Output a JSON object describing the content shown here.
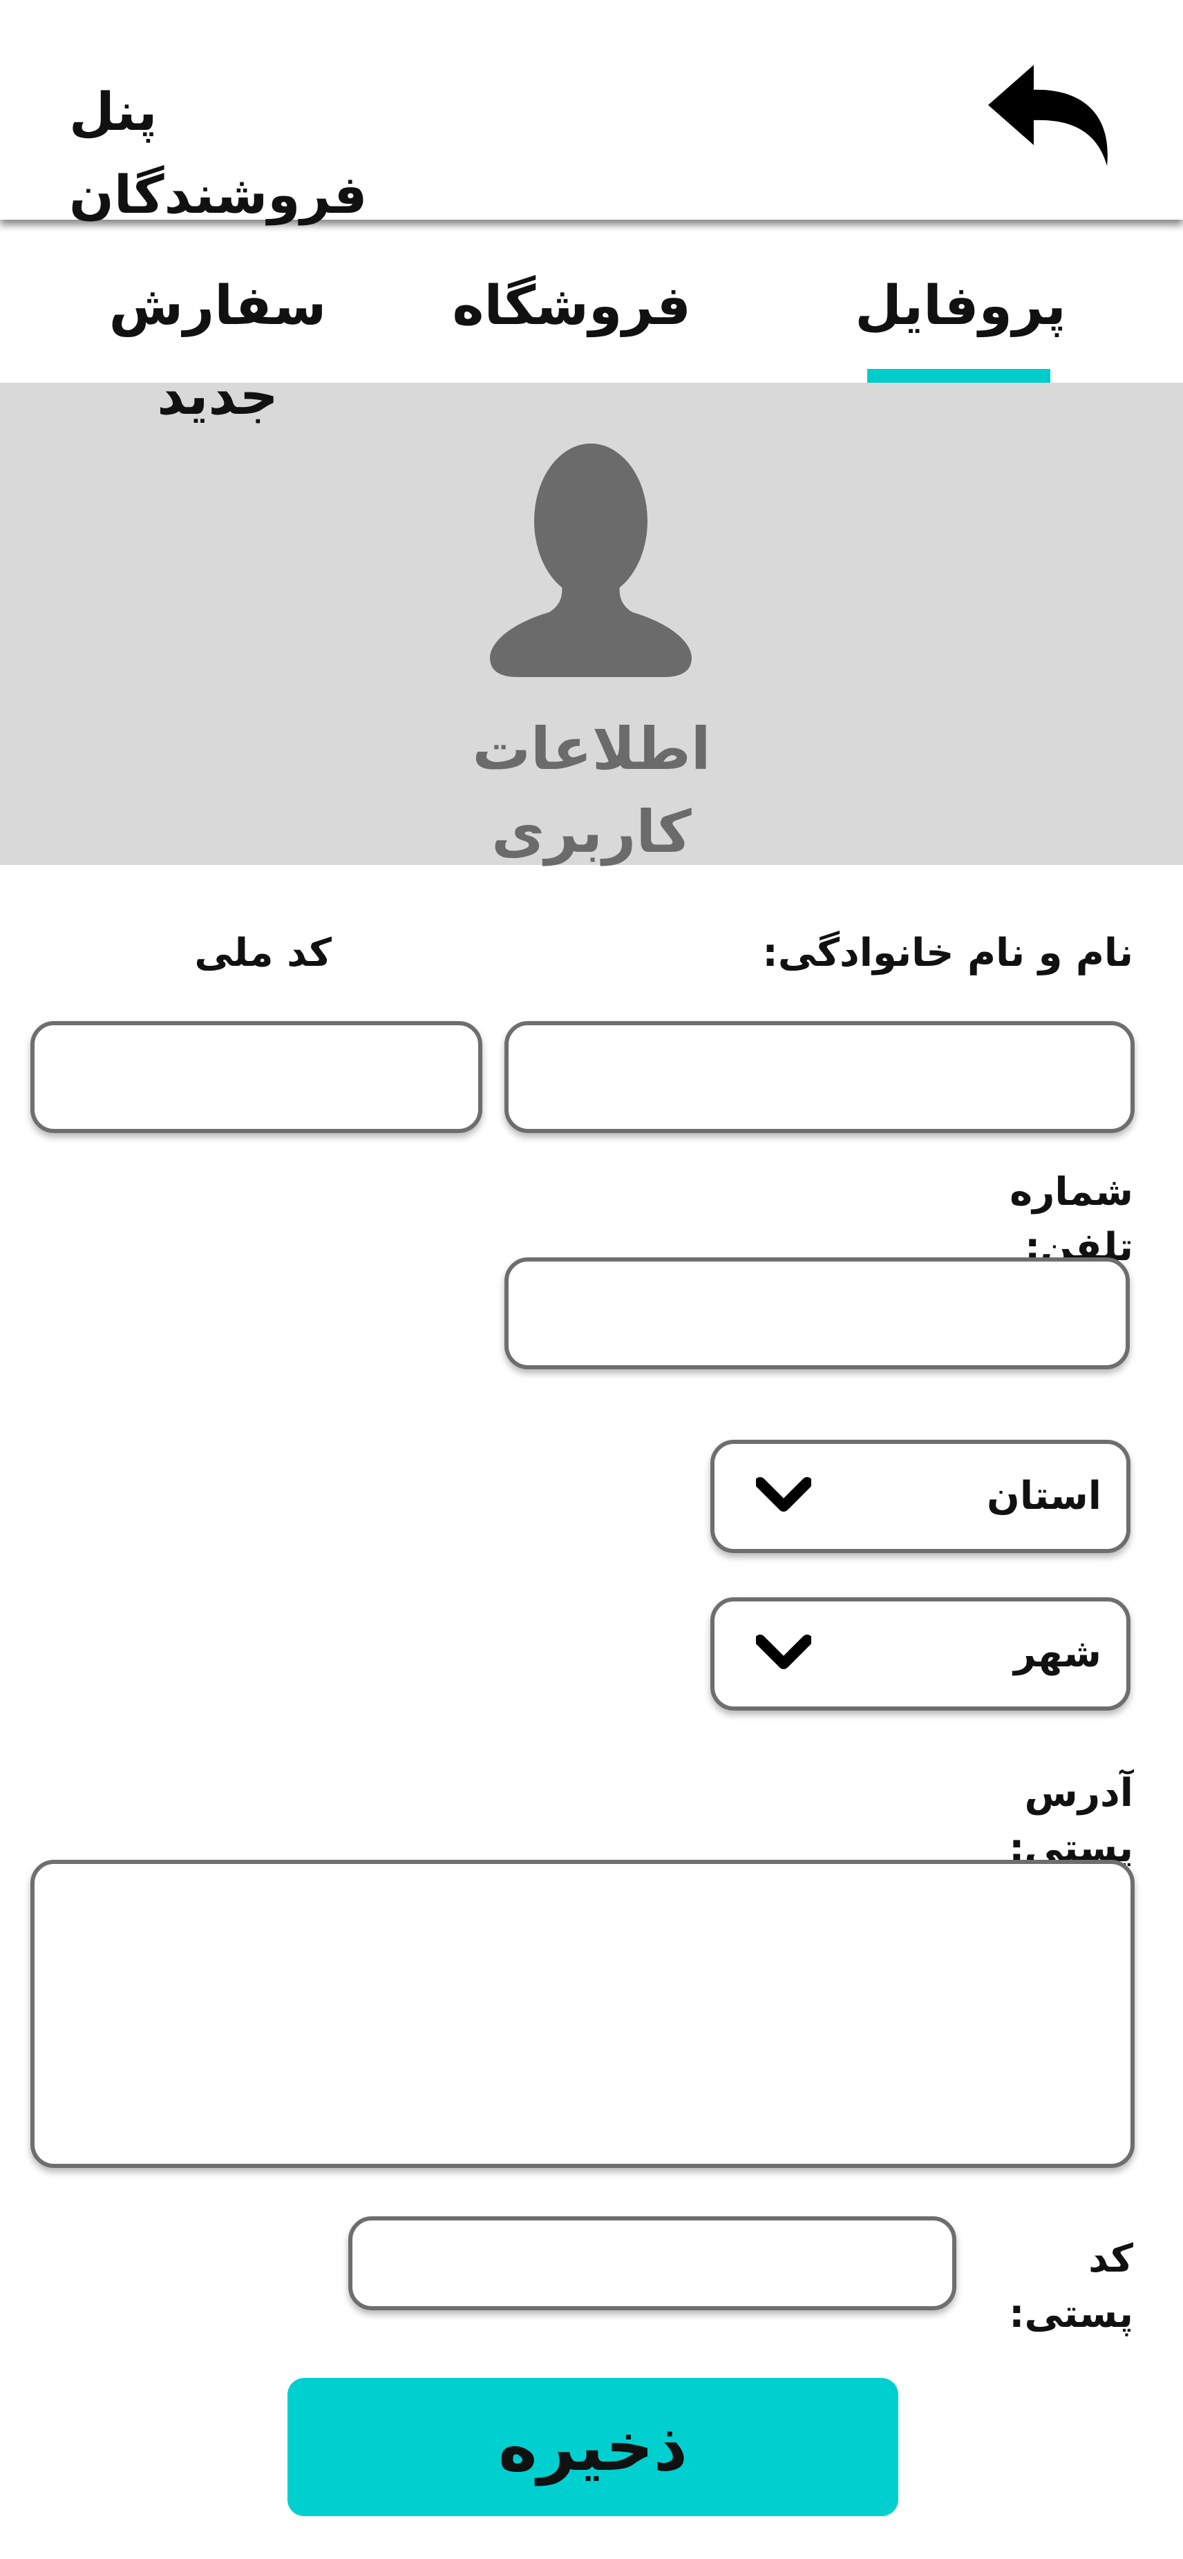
{
  "header": {
    "title": "پنل فروشندگان",
    "back_icon": "back-arrow-icon"
  },
  "tabs": [
    {
      "label": "پروفایل",
      "active": true
    },
    {
      "label": "فروشگاه",
      "active": false
    },
    {
      "label": "سفارش جدید",
      "active": false
    }
  ],
  "banner": {
    "avatar_icon": "user-avatar-icon",
    "caption": "اطلاعات کاربری"
  },
  "form": {
    "full_name_label": "نام و نام خانوادگی:",
    "full_name_value": "",
    "national_code_label": "کد ملی",
    "national_code_value": "",
    "phone_label": "شماره تلفن:",
    "phone_value": "",
    "province_selected": "استان",
    "city_selected": "شهر",
    "address_label": "آدرس پستی:",
    "address_value": "",
    "postal_code_label": "کد پستی:",
    "postal_code_value": "",
    "save_label": "ذخیره"
  },
  "colors": {
    "accent": "#00cfcf",
    "banner_bg": "#d9d9d9",
    "avatar": "#6b6b6b",
    "field_border": "#6e6e6e"
  }
}
